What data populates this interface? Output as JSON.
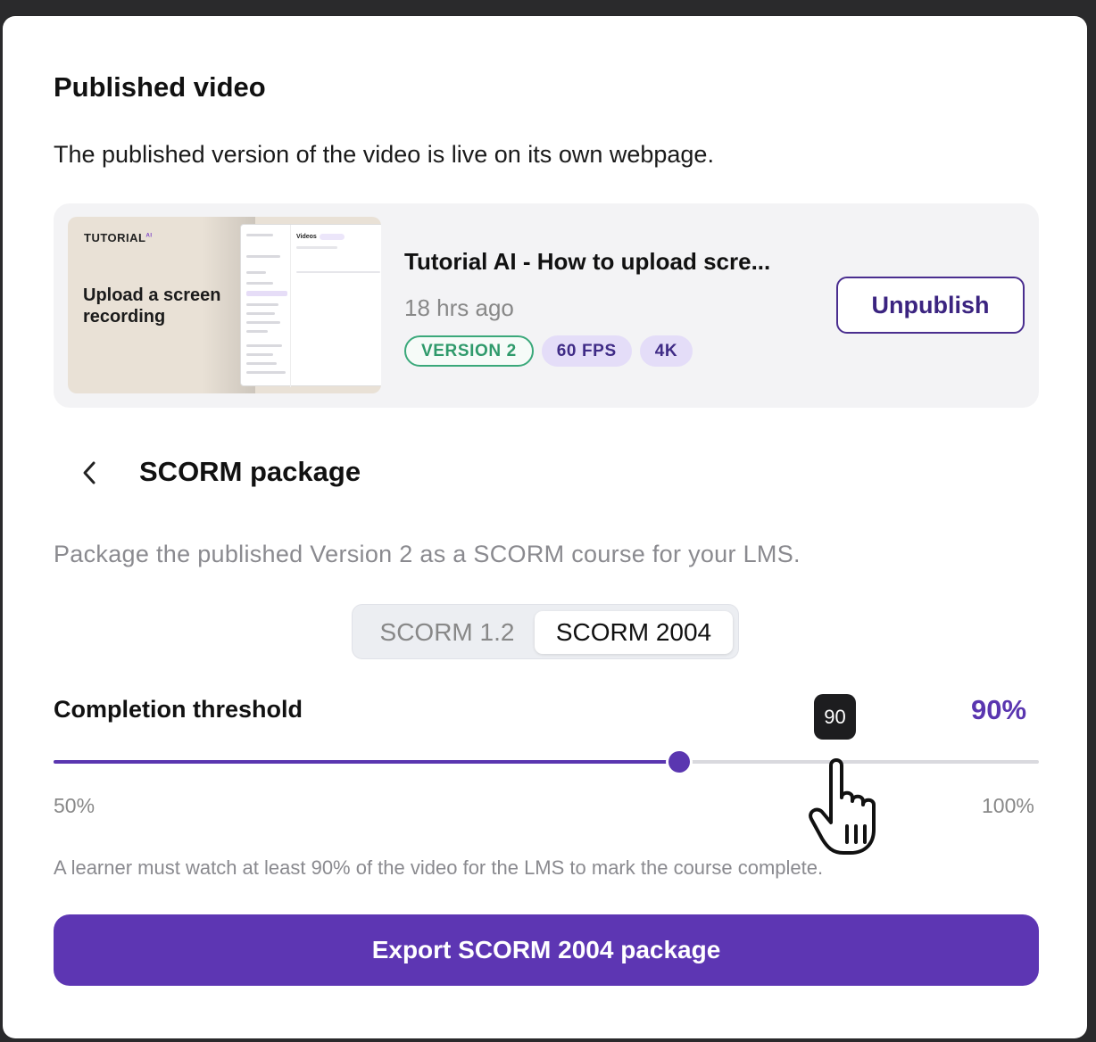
{
  "modal": {
    "title": "Published video",
    "subtitle": "The published version of the video is live on its own webpage."
  },
  "video": {
    "thumbnail": {
      "logo": "TUTORIAL",
      "logo_suffix": "AI",
      "caption": "Upload a screen recording",
      "screen_heading": "Videos"
    },
    "title": "Tutorial AI - How to upload scre...",
    "time": "18 hrs ago",
    "badges": [
      "VERSION 2",
      "60 FPS",
      "4K"
    ],
    "unpublish_label": "Unpublish"
  },
  "scorm": {
    "back_icon": "chevron-left-icon",
    "title": "SCORM package",
    "description": "Package the published Version 2 as a SCORM course for your LMS.",
    "versions": [
      "SCORM 1.2",
      "SCORM 2004"
    ],
    "selected_version": "SCORM 2004",
    "threshold": {
      "label": "Completion threshold",
      "value_text": "90%",
      "tooltip": "90",
      "value": 90,
      "min": 50,
      "max": 100,
      "min_label": "50%",
      "max_label": "100%",
      "helper": "A learner must watch at least 90% of the video for the LMS to mark the course complete."
    },
    "export_label": "Export SCORM 2004 package"
  },
  "colors": {
    "accent": "#5d36b3",
    "badge_green": "#3aa87a",
    "badge_purple_bg": "#e4ddf8"
  }
}
